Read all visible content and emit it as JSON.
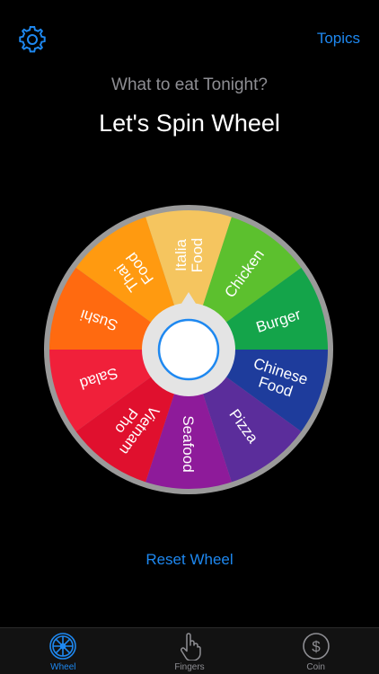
{
  "header": {
    "settings_icon": "gear-icon",
    "topics_label": "Topics"
  },
  "main": {
    "subtitle": "What to eat Tonight?",
    "title": "Let's Spin Wheel",
    "reset_label": "Reset Wheel"
  },
  "wheel": {
    "segments": [
      {
        "label": "Italia\nFood",
        "color": "#F5C55F"
      },
      {
        "label": "Chicken",
        "color": "#5CC02E"
      },
      {
        "label": "Burger",
        "color": "#14A44A"
      },
      {
        "label": "Chinese\nFood",
        "color": "#1E3C9C"
      },
      {
        "label": "Pizza",
        "color": "#5B2D9B"
      },
      {
        "label": "Seafood",
        "color": "#8E1B9A"
      },
      {
        "label": "Vietnam\nPho",
        "color": "#E0102E"
      },
      {
        "label": "Salad",
        "color": "#F0203A"
      },
      {
        "label": "Sushi",
        "color": "#FF6A10"
      },
      {
        "label": "Thai\nFood",
        "color": "#FF9A10"
      }
    ],
    "rim_color": "#9A9A9A",
    "hub_color": "#E4E4E4",
    "button_ring_color": "#1E88F0"
  },
  "tabbar": {
    "tabs": [
      {
        "label": "Wheel",
        "icon": "wheel-icon",
        "active": true
      },
      {
        "label": "Fingers",
        "icon": "finger-icon",
        "active": false
      },
      {
        "label": "Coin",
        "icon": "coin-icon",
        "active": false
      }
    ]
  }
}
